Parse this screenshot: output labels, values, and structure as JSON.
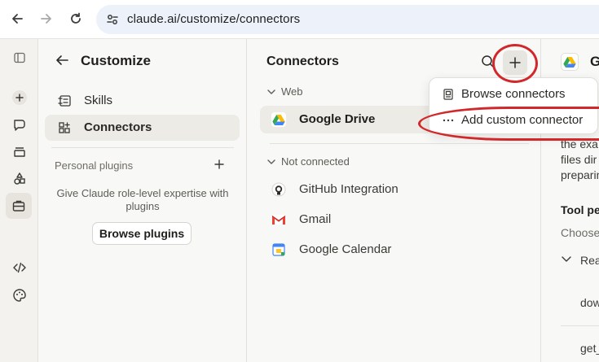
{
  "browser": {
    "url": "claude.ai/customize/connectors"
  },
  "customize": {
    "title": "Customize",
    "items": [
      {
        "label": "Skills"
      },
      {
        "label": "Connectors"
      }
    ],
    "personal_plugins_label": "Personal plugins",
    "plugins_desc": "Give Claude role-level expertise with plugins",
    "browse_plugins_label": "Browse plugins"
  },
  "connectors": {
    "title": "Connectors",
    "web_group": "Web",
    "web_items": [
      {
        "label": "Google Drive"
      }
    ],
    "not_connected_group": "Not connected",
    "not_connected_items": [
      {
        "label": "GitHub Integration"
      },
      {
        "label": "Gmail"
      },
      {
        "label": "Google Calendar"
      }
    ]
  },
  "menu": {
    "browse": "Browse connectors",
    "add_custom": "Add custom connector"
  },
  "detail": {
    "title": "Go",
    "lines": [
      "the exa",
      "files dir",
      "preparin"
    ],
    "tool_permissions": "Tool per",
    "choose": "Choose",
    "read": "Rea",
    "down": "dow",
    "get": "get_"
  },
  "colors": {
    "annotation": "#d0282b",
    "active_bg": "#ecebe6",
    "url_bg": "#edf1fa"
  }
}
